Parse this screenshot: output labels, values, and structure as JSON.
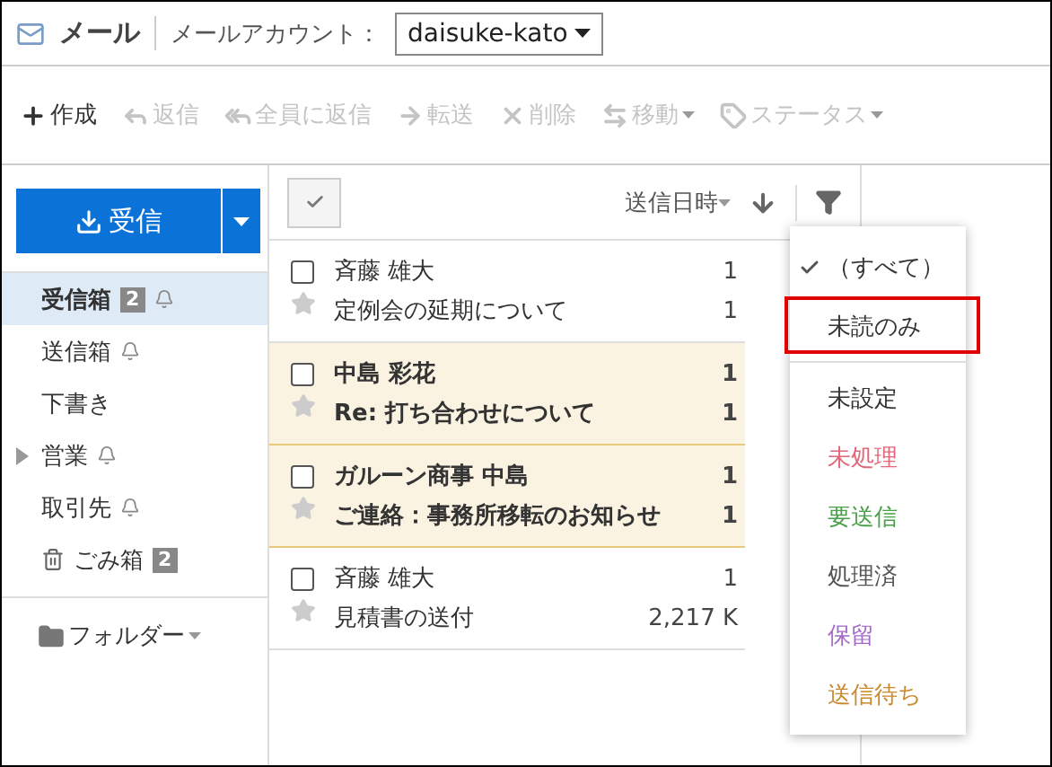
{
  "header": {
    "app_title": "メール",
    "account_label": "メールアカウント：",
    "account": "daisuke-kato"
  },
  "toolbar": [
    {
      "label": "作成",
      "kind": "plus",
      "disabled": false,
      "has_menu": false
    },
    {
      "label": "返信",
      "kind": "reply",
      "disabled": true,
      "has_menu": false
    },
    {
      "label": "全員に返信",
      "kind": "reply-all",
      "disabled": true,
      "has_menu": false
    },
    {
      "label": "転送",
      "kind": "forward",
      "disabled": true,
      "has_menu": false
    },
    {
      "label": "削除",
      "kind": "delete",
      "disabled": true,
      "has_menu": false
    },
    {
      "label": "移動",
      "kind": "move",
      "disabled": true,
      "has_menu": true
    },
    {
      "label": "ステータス",
      "kind": "tag",
      "disabled": true,
      "has_menu": true
    }
  ],
  "receive_button": {
    "label": "受信"
  },
  "sidebar": {
    "items": [
      {
        "label": "受信箱",
        "badge": "2",
        "bell": true,
        "selected": true,
        "kind": "folder"
      },
      {
        "label": "送信箱",
        "bell": true,
        "selected": false,
        "kind": "folder"
      },
      {
        "label": "下書き",
        "bell": false,
        "selected": false,
        "kind": "folder"
      },
      {
        "label": "営業",
        "bell": true,
        "selected": false,
        "kind": "collapsed"
      },
      {
        "label": "取引先",
        "bell": true,
        "selected": false,
        "kind": "folder"
      },
      {
        "label": "ごみ箱",
        "badge": "2",
        "bell": false,
        "selected": false,
        "kind": "trash"
      }
    ],
    "folder_menu": "フォルダー"
  },
  "list_header": {
    "sort_label": "送信日時"
  },
  "messages": [
    {
      "sender": "斉藤 雄大",
      "subject": "定例会の延期について",
      "date": "1",
      "size": "1",
      "unread": false,
      "selected": false
    },
    {
      "sender": "中島 彩花",
      "subject": "Re: 打ち合わせについて",
      "date": "1",
      "size": "1",
      "unread": true,
      "selected": true
    },
    {
      "sender": "ガルーン商事 中島",
      "subject": "ご連絡：事務所移転のお知らせ",
      "date": "1",
      "size": "1",
      "unread": true,
      "selected": true
    },
    {
      "sender": "斉藤 雄大",
      "subject": "見積書の送付",
      "date": "1",
      "size": "2,217 K",
      "unread": false,
      "selected": false
    }
  ],
  "filter_menu": {
    "items": [
      {
        "kind": "option",
        "label": "（すべて）",
        "checked": true,
        "highlighted": false,
        "color": "#333333"
      },
      {
        "kind": "option",
        "label": "未読のみ",
        "checked": false,
        "highlighted": true,
        "color": "#333333"
      },
      {
        "kind": "divider"
      },
      {
        "kind": "option",
        "label": "未設定",
        "checked": false,
        "highlighted": false,
        "color": "#333333"
      },
      {
        "kind": "option",
        "label": "未処理",
        "checked": false,
        "highlighted": false,
        "color": "#e0687a"
      },
      {
        "kind": "option",
        "label": "要送信",
        "checked": false,
        "highlighted": false,
        "color": "#4aa04a"
      },
      {
        "kind": "option",
        "label": "処理済",
        "checked": false,
        "highlighted": false,
        "color": "#555555"
      },
      {
        "kind": "option",
        "label": "保留",
        "checked": false,
        "highlighted": false,
        "color": "#a36bc7"
      },
      {
        "kind": "option",
        "label": "送信待ち",
        "checked": false,
        "highlighted": false,
        "color": "#c98a2e"
      }
    ]
  }
}
